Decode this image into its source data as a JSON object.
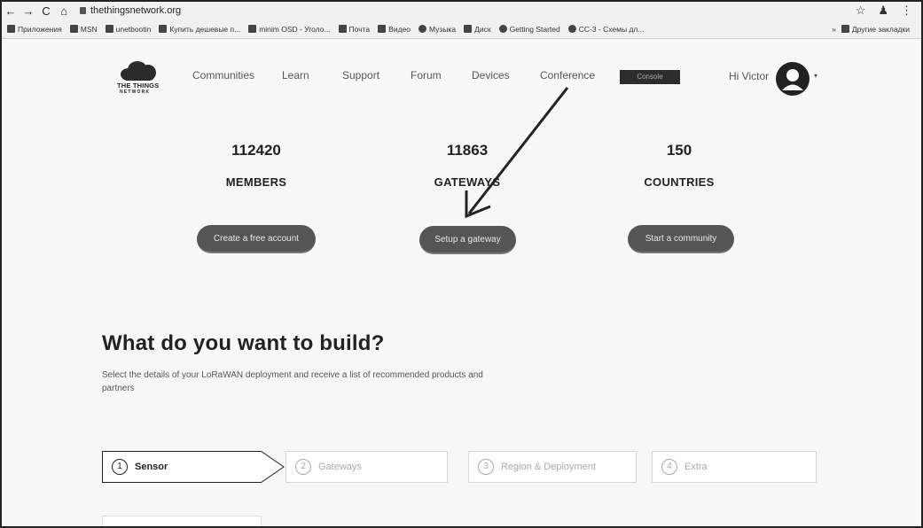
{
  "browser": {
    "nav": {
      "back": "←",
      "forward": "→",
      "reload": "C",
      "home": "⌂"
    },
    "url": "thethingsnetwork.org",
    "bookmarks": [
      {
        "label": "Приложения"
      },
      {
        "label": "MSN"
      },
      {
        "label": "unetbootin"
      },
      {
        "label": "Купить дешевые п..."
      },
      {
        "label": "minim OSD - Уголо..."
      },
      {
        "label": "Почта"
      },
      {
        "label": "Видео"
      },
      {
        "label": "Музыка"
      },
      {
        "label": "Диск"
      },
      {
        "label": "Getting Started"
      },
      {
        "label": "CC-3 - Схемы дл..."
      }
    ],
    "bookmarks_more": "»",
    "other_bookmarks": "Другие закладки"
  },
  "header": {
    "logo_line1": "THE THINGS",
    "logo_line2": "NETWORK",
    "nav": [
      "Communities",
      "Learn",
      "Support",
      "Forum",
      "Devices",
      "Conference"
    ],
    "console": "Console",
    "greeting": "Hi Victor"
  },
  "stats": [
    {
      "number": "112420",
      "label": "MEMBERS",
      "button": "Create a free account"
    },
    {
      "number": "11863",
      "label": "GATEWAYS",
      "button": "Setup a gateway"
    },
    {
      "number": "150",
      "label": "COUNTRIES",
      "button": "Start a community"
    }
  ],
  "build": {
    "title": "What do you want to build?",
    "subtitle": "Select the details of your LoRaWAN deployment and receive a list of recommended products and partners",
    "steps": [
      {
        "num": "1",
        "label": "Sensor"
      },
      {
        "num": "2",
        "label": "Gateways"
      },
      {
        "num": "3",
        "label": "Region & Deployment"
      },
      {
        "num": "4",
        "label": "Extra"
      }
    ]
  }
}
